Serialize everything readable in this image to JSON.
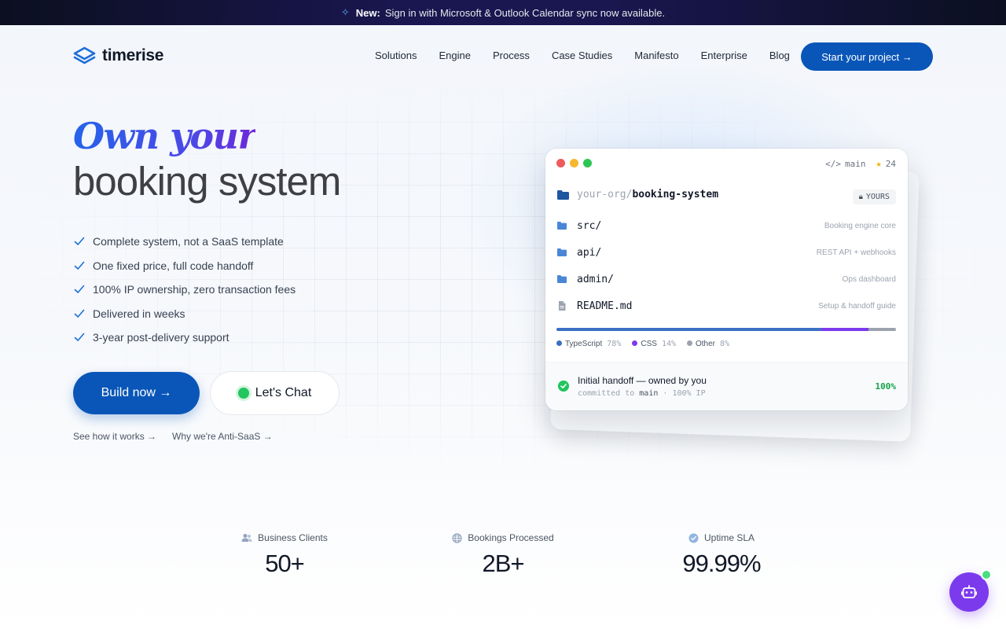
{
  "announcement": {
    "prefix": "New:",
    "text": "Sign in with Microsoft & Outlook Calendar sync now available."
  },
  "brand": {
    "name": "timerise",
    "accent": "#0a56b8"
  },
  "nav": {
    "items": [
      "Solutions",
      "Engine",
      "Process",
      "Case Studies",
      "Manifesto",
      "Enterprise",
      "Blog"
    ],
    "cta": "Start your project →"
  },
  "hero": {
    "title_line1": "Own your",
    "title_line2": "booking system",
    "features": [
      "Complete system, not a SaaS template",
      "One fixed price, full code handoff",
      "100% IP ownership, zero transaction fees",
      "Delivered in weeks",
      "3-year post-delivery support"
    ],
    "primary_button": "Build now →",
    "secondary_button": "Let's Chat",
    "links": [
      "See how it works →",
      "Why we're Anti-SaaS →"
    ]
  },
  "repo_card": {
    "branch": "main",
    "stars": "24",
    "org": "your-org/",
    "repo": "booking-system",
    "badge": "YOURS",
    "files": [
      {
        "name": "src/",
        "desc": "Booking engine core",
        "icon": "folder-icon"
      },
      {
        "name": "api/",
        "desc": "REST API + webhooks",
        "icon": "folder-icon"
      },
      {
        "name": "admin/",
        "desc": "Ops dashboard",
        "icon": "folder-icon"
      },
      {
        "name": "README.md",
        "desc": "Setup & handoff guide",
        "icon": "file-icon"
      }
    ],
    "languages": [
      {
        "name": "TypeScript",
        "pct": "78%",
        "share": 78,
        "color": "#3b6fc4"
      },
      {
        "name": "CSS",
        "pct": "14%",
        "share": 14,
        "color": "#7c3aed"
      },
      {
        "name": "Other",
        "pct": "8%",
        "share": 8,
        "color": "#9ca3af"
      }
    ],
    "commit": {
      "message": "Initial handoff — owned by you",
      "meta_prefix": "committed to",
      "meta_branch": "main",
      "meta_suffix": "· 100% IP",
      "percent": "100%"
    }
  },
  "stats": [
    {
      "label": "Business Clients",
      "value": "50+",
      "icon": "users-icon"
    },
    {
      "label": "Bookings Processed",
      "value": "2B+",
      "icon": "globe-icon"
    },
    {
      "label": "Uptime SLA",
      "value": "99.99%",
      "icon": "verified-icon"
    }
  ]
}
